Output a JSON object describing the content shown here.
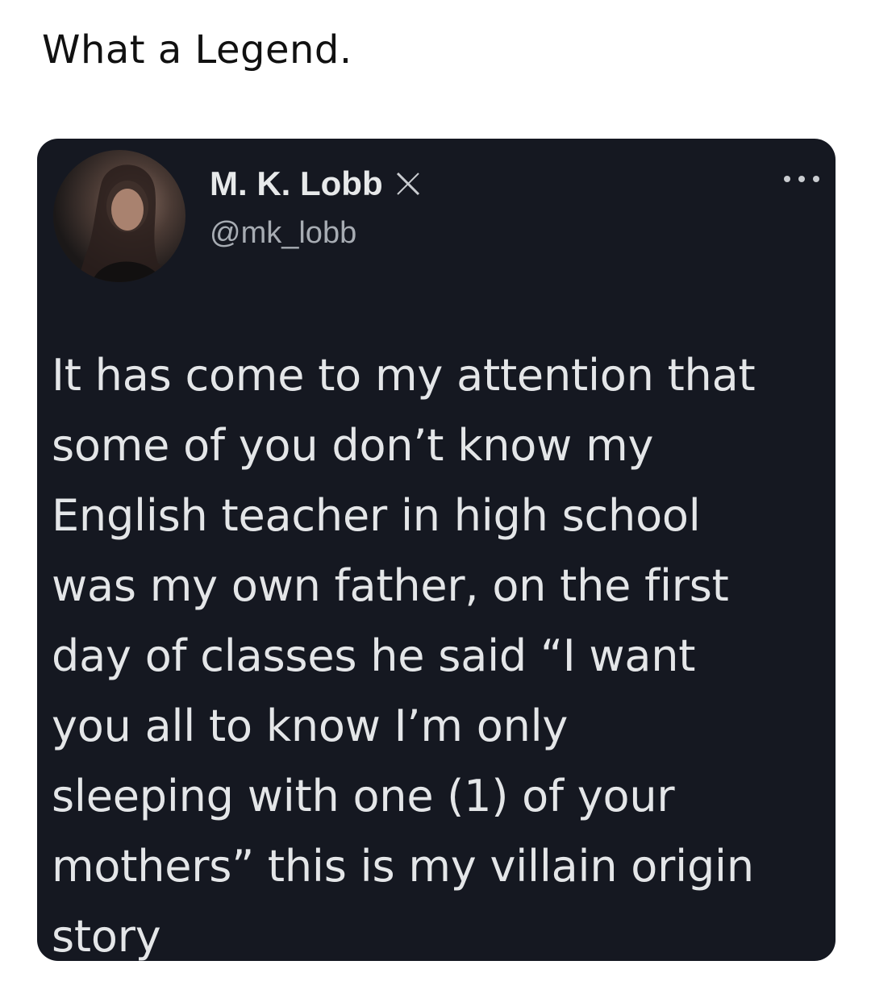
{
  "caption": "What a Legend.",
  "tweet": {
    "display_name": "M. K. Lobb",
    "handle": "@mk_lobb",
    "lines": [
      "It has come to my attention that",
      "some of you don’t know my",
      "English teacher in high school",
      "was my own father, on the first",
      "day of classes he said “I want",
      "you all to know I’m only",
      "sleeping with one (1) of your",
      "mothers” this is my villain origin",
      "story"
    ]
  },
  "icons": {
    "badge": "x-logo-icon",
    "menu": "more-options-icon"
  },
  "colors": {
    "card_background": "#151821",
    "text_primary": "#e4e6e8",
    "text_secondary": "#a7acb3"
  }
}
